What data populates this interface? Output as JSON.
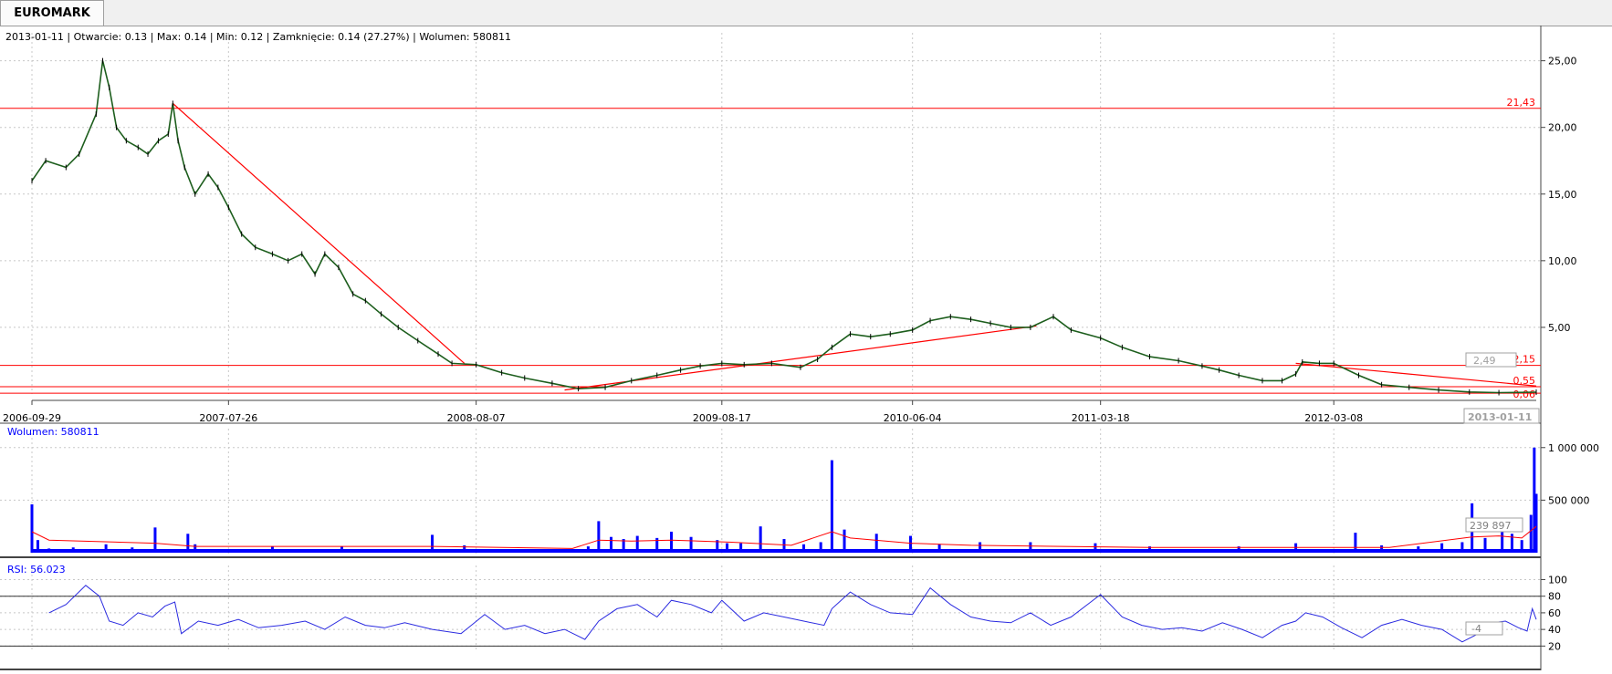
{
  "window": {
    "tab_label": "EUROMARK"
  },
  "info_line": "2013-01-11 | Otwarcie: 0.13 | Max: 0.14 | Min: 0.12 | Zamknięcie: 0.14 (27.27%)  | Wolumen: 580811",
  "colors": {
    "price": "#1d5e1d",
    "trend": "#ff0000",
    "volume": "#0000ff",
    "volume_avg": "#ff0000",
    "rsi": "#2a2ae0",
    "grid": "#c8c8c8"
  },
  "chart_data": [
    {
      "type": "line",
      "name": "price-panel",
      "x_dates": [
        "2006-09-29",
        "2007-07-26",
        "2008-08-07",
        "2009-08-17",
        "2010-06-04",
        "2011-03-18",
        "2012-03-08"
      ],
      "x_range": [
        "2006-09-29",
        "2013-01-11"
      ],
      "y_ticks": [
        25,
        20,
        15,
        10,
        5
      ],
      "y_tick_labels": [
        "25,00",
        "20,00",
        "15,00",
        "10,00",
        "5,00"
      ],
      "ylim": [
        0,
        26
      ],
      "current_price_label": "2,49",
      "last_date_label": "2013-01-11",
      "horizontal_levels": [
        {
          "value": 21.43,
          "label": "21,43"
        },
        {
          "value": 2.15,
          "label": "2,15"
        },
        {
          "value": 0.55,
          "label": "0,55"
        },
        {
          "value": 0.06,
          "label": "0,06"
        }
      ],
      "trend_lines": [
        {
          "from": [
            "2007-05-02",
            21.8
          ],
          "to": [
            "2008-07-20",
            2.3
          ]
        },
        {
          "from": [
            "2008-12-20",
            0.3
          ],
          "to": [
            "2010-12-10",
            5.1
          ]
        },
        {
          "from": [
            "2012-01-10",
            2.3
          ],
          "to": [
            "2013-01-11",
            0.6
          ]
        }
      ],
      "series": [
        {
          "dates": [
            "2006-09-29",
            "2006-10-20",
            "2006-11-20",
            "2006-12-10",
            "2007-01-05",
            "2007-01-15",
            "2007-01-25",
            "2007-02-05",
            "2007-02-20",
            "2007-03-10",
            "2007-03-25",
            "2007-04-10",
            "2007-04-25",
            "2007-05-02",
            "2007-05-10",
            "2007-05-20",
            "2007-06-05",
            "2007-06-25",
            "2007-07-10",
            "2007-07-26",
            "2007-08-15",
            "2007-09-05",
            "2007-10-01",
            "2007-10-25",
            "2007-11-15",
            "2007-12-05",
            "2007-12-20",
            "2008-01-10",
            "2008-02-01",
            "2008-02-20",
            "2008-03-15",
            "2008-04-10",
            "2008-05-10",
            "2008-06-10",
            "2008-07-01",
            "2008-08-07",
            "2008-09-15",
            "2008-10-20",
            "2008-12-01",
            "2009-01-10",
            "2009-02-20",
            "2009-04-01",
            "2009-05-10",
            "2009-06-15",
            "2009-07-15",
            "2009-08-17",
            "2009-09-20",
            "2009-11-01",
            "2009-12-15",
            "2010-01-10",
            "2010-02-01",
            "2010-03-01",
            "2010-04-01",
            "2010-05-01",
            "2010-06-04",
            "2010-07-01",
            "2010-08-01",
            "2010-09-01",
            "2010-10-01",
            "2010-11-01",
            "2010-12-01",
            "2011-01-05",
            "2011-02-01",
            "2011-03-18",
            "2011-04-20",
            "2011-06-01",
            "2011-07-15",
            "2011-08-20",
            "2011-09-15",
            "2011-10-15",
            "2011-11-20",
            "2011-12-20",
            "2012-01-10",
            "2012-01-20",
            "2012-02-15",
            "2012-03-08",
            "2012-04-15",
            "2012-05-20",
            "2012-07-01",
            "2012-08-15",
            "2012-10-01",
            "2012-11-15",
            "2013-01-11"
          ],
          "values": [
            16.0,
            17.5,
            17.0,
            18.0,
            21.0,
            25.0,
            23.0,
            20.0,
            19.0,
            18.5,
            18.0,
            19.0,
            19.5,
            21.8,
            19.0,
            17.0,
            15.0,
            16.5,
            15.5,
            14.0,
            12.0,
            11.0,
            10.5,
            10.0,
            10.5,
            9.0,
            10.5,
            9.5,
            7.5,
            7.0,
            6.0,
            5.0,
            4.0,
            3.0,
            2.3,
            2.2,
            1.6,
            1.2,
            0.8,
            0.4,
            0.5,
            1.0,
            1.4,
            1.8,
            2.1,
            2.3,
            2.2,
            2.3,
            2.0,
            2.6,
            3.5,
            4.5,
            4.3,
            4.5,
            4.8,
            5.5,
            5.8,
            5.6,
            5.3,
            5.0,
            5.0,
            5.8,
            4.8,
            4.2,
            3.5,
            2.8,
            2.5,
            2.1,
            1.8,
            1.4,
            1.0,
            1.0,
            1.5,
            2.4,
            2.3,
            2.3,
            1.4,
            0.7,
            0.5,
            0.3,
            0.15,
            0.1,
            0.14
          ]
        }
      ]
    },
    {
      "type": "bar",
      "name": "volume-panel",
      "title": "Wolumen: 580811",
      "y_ticks": [
        1000000,
        500000
      ],
      "y_tick_labels": [
        "1 000 000",
        "500 000"
      ],
      "ylim": [
        0,
        1050000
      ],
      "current_value_label": "239 897",
      "series": [
        {
          "name": "Wolumen",
          "dates": [
            "2006-09-29",
            "2006-10-08",
            "2006-10-25",
            "2006-12-01",
            "2007-01-20",
            "2007-03-01",
            "2007-04-05",
            "2007-05-25",
            "2007-06-05",
            "2007-10-01",
            "2008-01-15",
            "2008-06-01",
            "2008-07-20",
            "2008-11-01",
            "2009-01-25",
            "2009-02-10",
            "2009-03-01",
            "2009-03-20",
            "2009-04-10",
            "2009-05-10",
            "2009-06-01",
            "2009-07-01",
            "2009-08-10",
            "2009-08-25",
            "2009-09-15",
            "2009-10-15",
            "2009-11-20",
            "2009-12-20",
            "2010-01-15",
            "2010-02-01",
            "2010-02-20",
            "2010-04-10",
            "2010-06-01",
            "2010-07-15",
            "2010-09-15",
            "2010-12-01",
            "2011-03-10",
            "2011-06-01",
            "2011-10-15",
            "2012-01-10",
            "2012-04-10",
            "2012-05-20",
            "2012-07-15",
            "2012-08-20",
            "2012-09-20",
            "2012-10-05",
            "2012-10-25",
            "2012-11-20",
            "2012-12-05",
            "2012-12-20",
            "2013-01-03",
            "2013-01-08",
            "2013-01-11"
          ],
          "values": [
            460000,
            120000,
            40000,
            50000,
            80000,
            50000,
            240000,
            180000,
            80000,
            60000,
            60000,
            170000,
            70000,
            30000,
            60000,
            300000,
            150000,
            130000,
            160000,
            140000,
            200000,
            150000,
            120000,
            90000,
            90000,
            250000,
            130000,
            80000,
            100000,
            880000,
            220000,
            180000,
            160000,
            80000,
            100000,
            100000,
            90000,
            60000,
            60000,
            90000,
            190000,
            70000,
            60000,
            90000,
            100000,
            470000,
            140000,
            330000,
            180000,
            120000,
            360000,
            1000000,
            560000
          ]
        },
        {
          "name": "Średnia",
          "dates": [
            "2006-09-29",
            "2006-10-25",
            "2007-04-05",
            "2007-06-05",
            "2008-06-01",
            "2009-01-01",
            "2009-02-10",
            "2009-04-01",
            "2009-06-01",
            "2009-09-01",
            "2009-12-01",
            "2010-02-01",
            "2010-03-01",
            "2010-06-01",
            "2010-09-01",
            "2011-06-01",
            "2012-06-01",
            "2012-10-05",
            "2012-11-15",
            "2012-12-20",
            "2013-01-11"
          ],
          "values": [
            200000,
            120000,
            90000,
            60000,
            60000,
            40000,
            120000,
            110000,
            120000,
            100000,
            70000,
            200000,
            140000,
            90000,
            70000,
            50000,
            50000,
            150000,
            160000,
            140000,
            250000
          ]
        }
      ]
    },
    {
      "type": "line",
      "name": "rsi-panel",
      "title": "RSI: 56.023",
      "y_ticks": [
        100,
        80,
        60,
        40,
        20
      ],
      "y_tick_labels": [
        "100",
        "80",
        "60",
        "40",
        "20"
      ],
      "ylim": [
        16,
        106
      ],
      "reference_lines": [
        80,
        20
      ],
      "current_value_label": "-4",
      "series": [
        {
          "name": "RSI",
          "dates": [
            "2006-10-25",
            "2006-11-20",
            "2006-12-20",
            "2007-01-10",
            "2007-01-25",
            "2007-02-15",
            "2007-03-10",
            "2007-04-01",
            "2007-04-20",
            "2007-05-05",
            "2007-05-15",
            "2007-06-10",
            "2007-07-10",
            "2007-08-10",
            "2007-09-10",
            "2007-10-15",
            "2007-11-20",
            "2007-12-20",
            "2008-01-20",
            "2008-02-20",
            "2008-03-20",
            "2008-04-20",
            "2008-06-01",
            "2008-07-15",
            "2008-08-20",
            "2008-09-20",
            "2008-10-20",
            "2008-11-20",
            "2008-12-20",
            "2009-01-20",
            "2009-02-10",
            "2009-03-10",
            "2009-04-10",
            "2009-05-10",
            "2009-06-01",
            "2009-07-01",
            "2009-08-01",
            "2009-08-17",
            "2009-09-20",
            "2009-10-20",
            "2009-11-20",
            "2009-12-20",
            "2010-01-20",
            "2010-02-01",
            "2010-03-01",
            "2010-04-01",
            "2010-05-01",
            "2010-06-04",
            "2010-07-01",
            "2010-08-01",
            "2010-09-01",
            "2010-10-01",
            "2010-11-01",
            "2010-12-01",
            "2011-01-01",
            "2011-02-01",
            "2011-03-18",
            "2011-04-20",
            "2011-05-20",
            "2011-06-20",
            "2011-07-20",
            "2011-08-20",
            "2011-09-20",
            "2011-10-20",
            "2011-11-20",
            "2011-12-20",
            "2012-01-10",
            "2012-01-25",
            "2012-02-20",
            "2012-03-20",
            "2012-04-20",
            "2012-05-20",
            "2012-06-20",
            "2012-07-20",
            "2012-08-20",
            "2012-09-20",
            "2012-10-15",
            "2012-11-05",
            "2012-11-25",
            "2012-12-15",
            "2012-12-28",
            "2013-01-05",
            "2013-01-11"
          ],
          "values": [
            60,
            70,
            93,
            80,
            50,
            45,
            60,
            55,
            68,
            73,
            35,
            50,
            45,
            52,
            42,
            45,
            50,
            40,
            55,
            45,
            42,
            48,
            40,
            35,
            58,
            40,
            45,
            35,
            40,
            28,
            50,
            65,
            70,
            55,
            75,
            70,
            60,
            75,
            50,
            60,
            55,
            50,
            45,
            65,
            85,
            70,
            60,
            58,
            90,
            70,
            55,
            50,
            48,
            60,
            45,
            55,
            82,
            55,
            45,
            40,
            42,
            38,
            48,
            40,
            30,
            45,
            50,
            60,
            55,
            42,
            30,
            45,
            52,
            45,
            40,
            25,
            35,
            48,
            50,
            42,
            38,
            65,
            52
          ]
        }
      ]
    }
  ]
}
